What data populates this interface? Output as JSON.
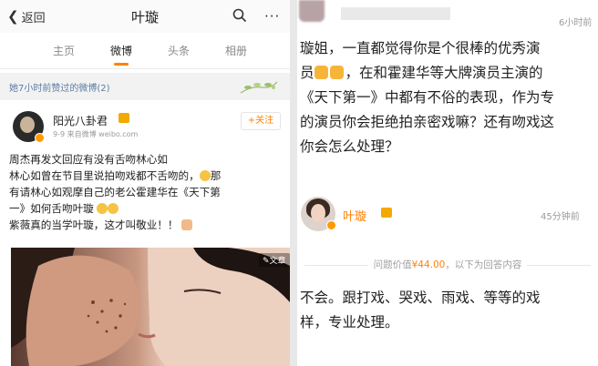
{
  "left": {
    "header": {
      "back_label": "返回",
      "title": "叶璇",
      "more_label": "···"
    },
    "tabs": [
      {
        "label": "主页",
        "active": false
      },
      {
        "label": "微博",
        "active": true
      },
      {
        "label": "头条",
        "active": false
      },
      {
        "label": "相册",
        "active": false
      }
    ],
    "praised_bar": "她7小时前赞过的微博(2)",
    "post": {
      "author": "阳光八卦君",
      "meta": "9-9  来自微博 weibo.com",
      "follow_label": "+关注",
      "lines": [
        "周杰再发文回应有没有舌吻林心如",
        "林心如曾在节目里说拍吻戏都不舌吻的，",
        "那",
        "有请林心如观摩自己的老公霍建华在《天下第",
        "一》如何舌吻叶璇",
        "紫薇真的当学叶璇，这才叫敬业！！"
      ],
      "image_badge": "文章"
    },
    "accent_color": "#ff8200"
  },
  "right": {
    "question_time": "6小时前",
    "question_lines": [
      "璇姐，一直都觉得你是个很棒的优秀演",
      "员",
      "，在和霍建华等大牌演员主演的",
      "《天下第一》中都有不俗的表现，作为专",
      "的演员你会拒绝拍亲密戏嘛？还有吻戏这",
      "你会怎么处理？"
    ],
    "answerer": "叶璇",
    "answer_time": "45分钟前",
    "rule_prefix": "问题价值",
    "rule_price": "¥44.00",
    "rule_suffix": "，以下为回答内容",
    "answer_lines": [
      "不会。跟打戏、哭戏、雨戏、等等的戏",
      "样，专业处理。"
    ]
  }
}
